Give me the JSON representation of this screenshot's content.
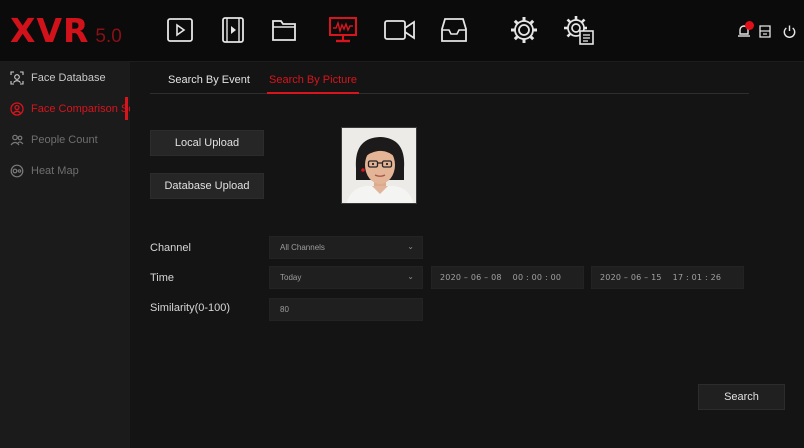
{
  "logo": {
    "brand": "XVR",
    "version": "5.0"
  },
  "topbar": {
    "icons": [
      "play-icon",
      "video-file-icon",
      "folder-icon",
      "monitor-wave-icon",
      "camera-icon",
      "inbox-icon",
      "gear-icon",
      "settings-list-icon"
    ],
    "active_icon": "monitor-wave-icon",
    "right_icons": [
      "alarm-icon",
      "storage-icon",
      "power-icon"
    ]
  },
  "sidebar": {
    "items": [
      {
        "label": "Face Database",
        "icon": "face-scan-icon",
        "state": "normal"
      },
      {
        "label": "Face Comparison Sea",
        "icon": "face-compare-icon",
        "state": "active"
      },
      {
        "label": "People Count",
        "icon": "people-icon",
        "state": "dim"
      },
      {
        "label": "Heat Map",
        "icon": "heatmap-icon",
        "state": "dim"
      }
    ]
  },
  "tabs": {
    "by_event": "Search By Event",
    "by_picture": "Search By Picture",
    "active": "by_picture"
  },
  "upload": {
    "local": "Local Upload",
    "database": "Database Upload"
  },
  "form": {
    "channel_label": "Channel",
    "channel_value": "All Channels",
    "time_label": "Time",
    "time_value": "Today",
    "start_datetime": "2020 – 06 – 08    00 : 00 : 00",
    "end_datetime": "2020 – 06 – 15    17 : 01 : 26",
    "similarity_label": "Similarity(0-100)",
    "similarity_value": "80"
  },
  "search_button": "Search",
  "colors": {
    "accent": "#d8141d",
    "background": "#141414",
    "sidebar": "#1b1b1b",
    "button": "#262626"
  }
}
